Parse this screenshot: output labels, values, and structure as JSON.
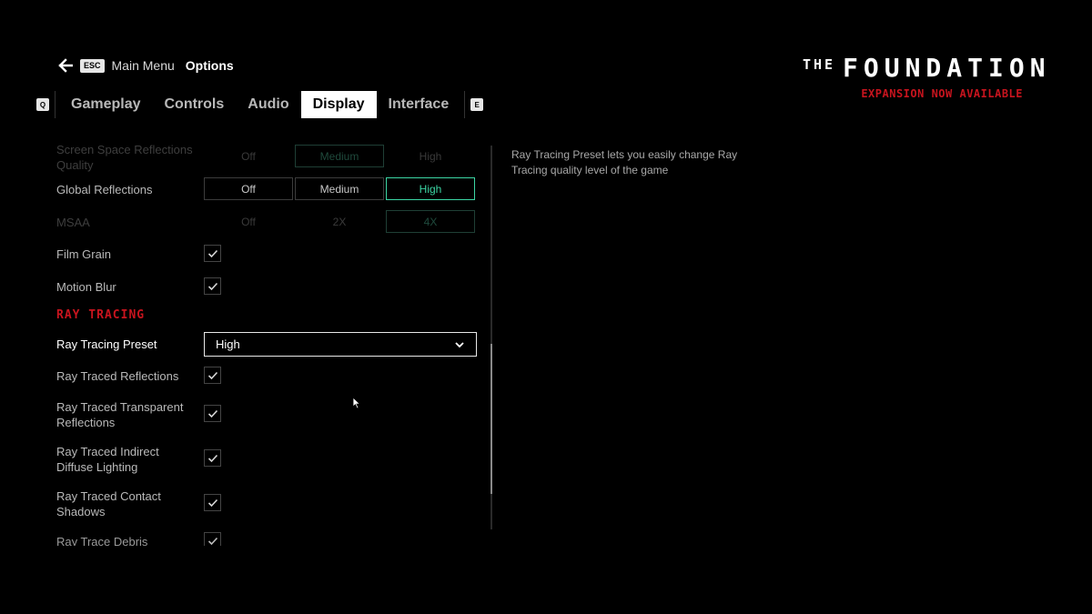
{
  "breadcrumb": {
    "esc_key": "ESC",
    "main_menu": "Main Menu",
    "current": "Options",
    "back_icon": "arrow-left-icon"
  },
  "tabs": {
    "left_key": "Q",
    "right_key": "E",
    "items": [
      {
        "label": "Gameplay",
        "active": false
      },
      {
        "label": "Controls",
        "active": false
      },
      {
        "label": "Audio",
        "active": false
      },
      {
        "label": "Display",
        "active": true
      },
      {
        "label": "Interface",
        "active": false
      }
    ]
  },
  "logo": {
    "the": "THE",
    "name": "FOUNDATION",
    "tagline": "EXPANSION NOW AVAILABLE"
  },
  "settings": {
    "ssr_quality": {
      "label": "Screen Space Reflections Quality",
      "options": [
        "Off",
        "Medium",
        "High"
      ],
      "selected": "Medium"
    },
    "global_reflections": {
      "label": "Global Reflections",
      "options": [
        "Off",
        "Medium",
        "High"
      ],
      "selected": "High"
    },
    "msaa": {
      "label": "MSAA",
      "options": [
        "Off",
        "2X",
        "4X"
      ],
      "selected": "4X"
    },
    "film_grain": {
      "label": "Film Grain",
      "checked": true
    },
    "motion_blur": {
      "label": "Motion Blur",
      "checked": true
    },
    "ray_tracing_section": "RAY TRACING",
    "ray_tracing_preset": {
      "label": "Ray Tracing Preset",
      "value": "High"
    },
    "rt_reflections": {
      "label": "Ray Traced Reflections",
      "checked": true
    },
    "rt_transparent_reflections": {
      "label": "Ray Traced Transparent Reflections",
      "checked": true
    },
    "rt_indirect_diffuse": {
      "label": "Ray Traced Indirect Diffuse Lighting",
      "checked": true
    },
    "rt_contact_shadows": {
      "label": "Ray Traced Contact Shadows",
      "checked": true
    },
    "rt_debris": {
      "label": "Ray Trace Debris",
      "checked": true
    }
  },
  "description": "Ray Tracing Preset lets you easily change Ray Tracing quality level of the game",
  "colors": {
    "accent": "#3cd6a4",
    "section_red": "#c8141e",
    "background": "#000000"
  }
}
